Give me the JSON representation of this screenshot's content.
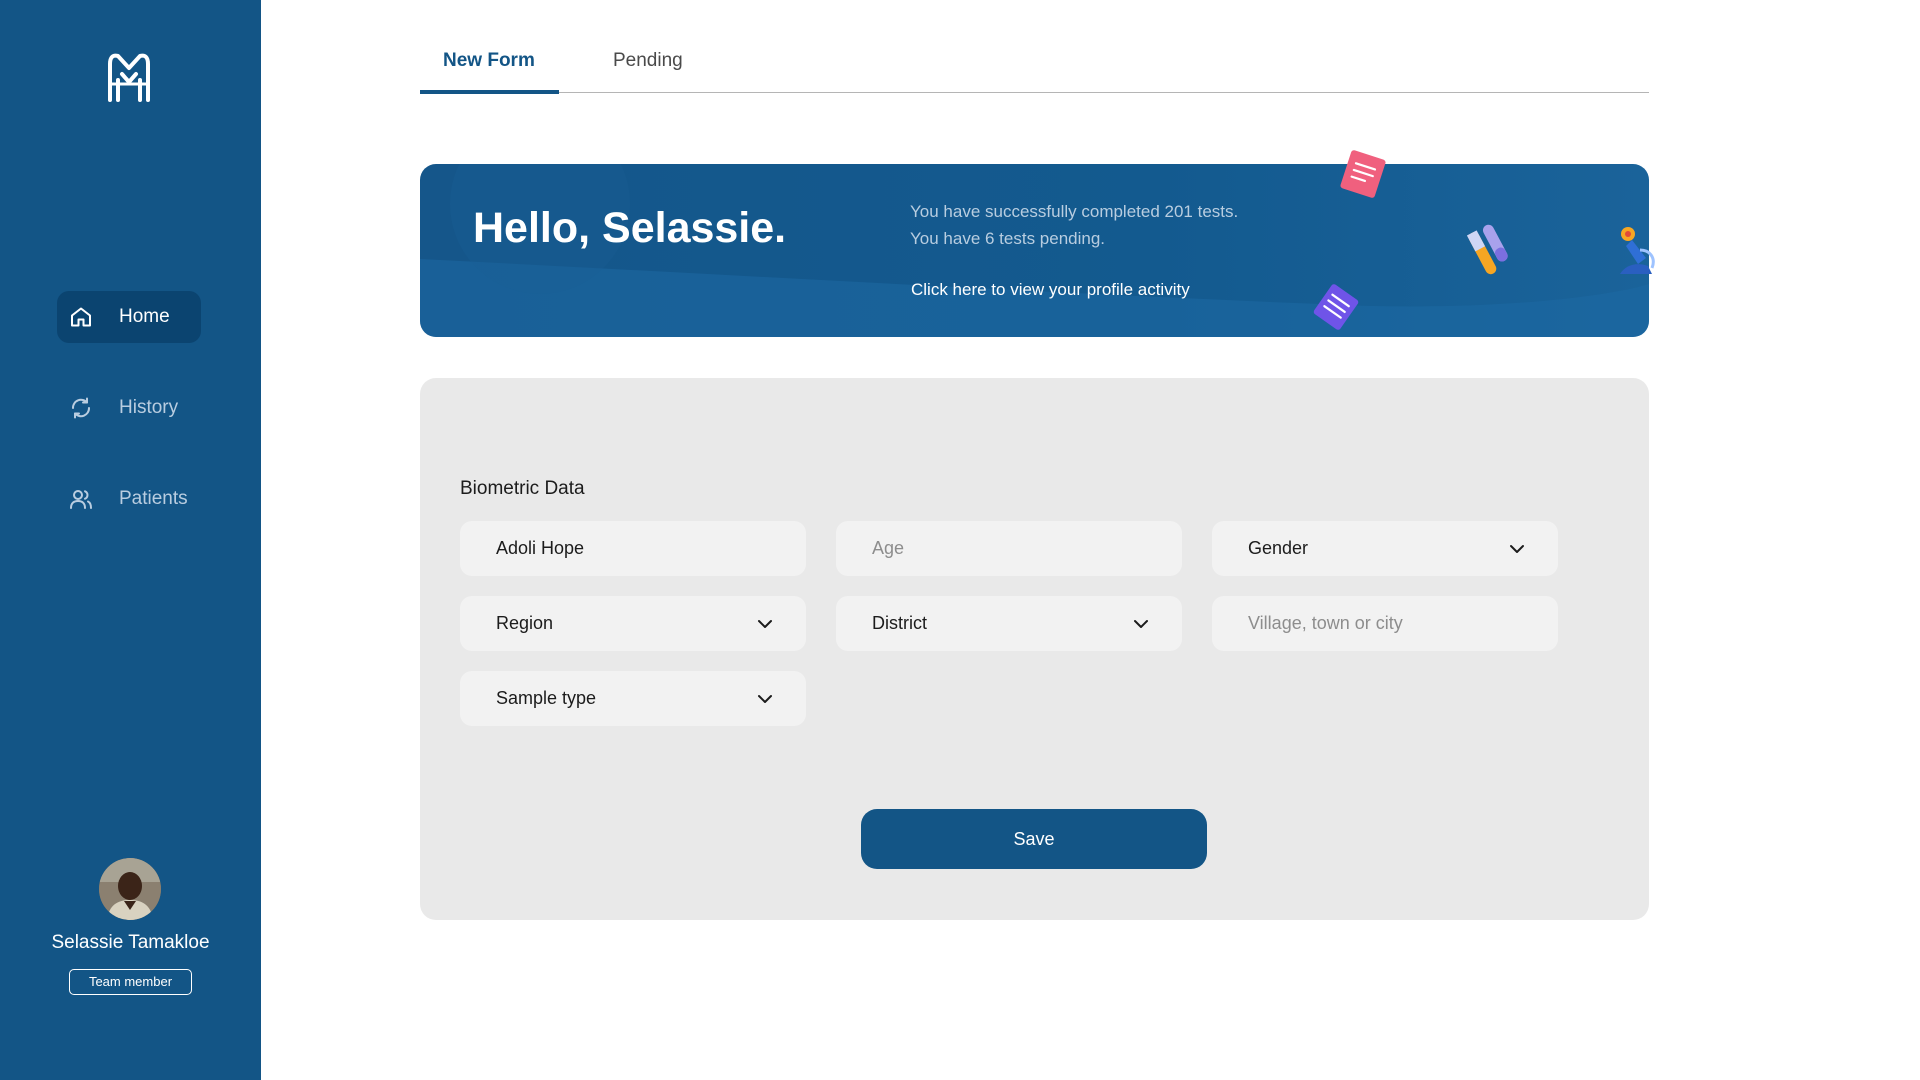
{
  "sidebar": {
    "logo_icon": "m-monogram-logo",
    "nav": [
      {
        "label": "Home",
        "icon": "home-icon",
        "active": true
      },
      {
        "label": "History",
        "icon": "refresh-icon",
        "active": false
      },
      {
        "label": "Patients",
        "icon": "users-icon",
        "active": false
      }
    ],
    "user": {
      "name": "Selassie Tamakloe",
      "role": "Team member"
    }
  },
  "tabs": [
    {
      "label": "New Form",
      "active": true
    },
    {
      "label": "Pending",
      "active": false
    }
  ],
  "banner": {
    "greeting": "Hello, Selassie.",
    "stat_completed": "You have successfully completed 201 tests.",
    "stat_pending": "You have 6 tests pending.",
    "link": "Click here to view your profile activity"
  },
  "form": {
    "section_title": "Biometric Data",
    "fields": {
      "name": {
        "value": "Adoli Hope"
      },
      "age": {
        "placeholder": "Age"
      },
      "gender": {
        "value": "Gender"
      },
      "region": {
        "value": "Region"
      },
      "district": {
        "value": "District"
      },
      "village": {
        "placeholder": "Village, town or city"
      },
      "sample_type": {
        "value": "Sample type"
      }
    },
    "save_label": "Save"
  },
  "colors": {
    "primary": "#135586",
    "sidebar_active": "#0b4470",
    "card_bg": "#e9e9e9",
    "field_bg": "#f2f2f2"
  }
}
